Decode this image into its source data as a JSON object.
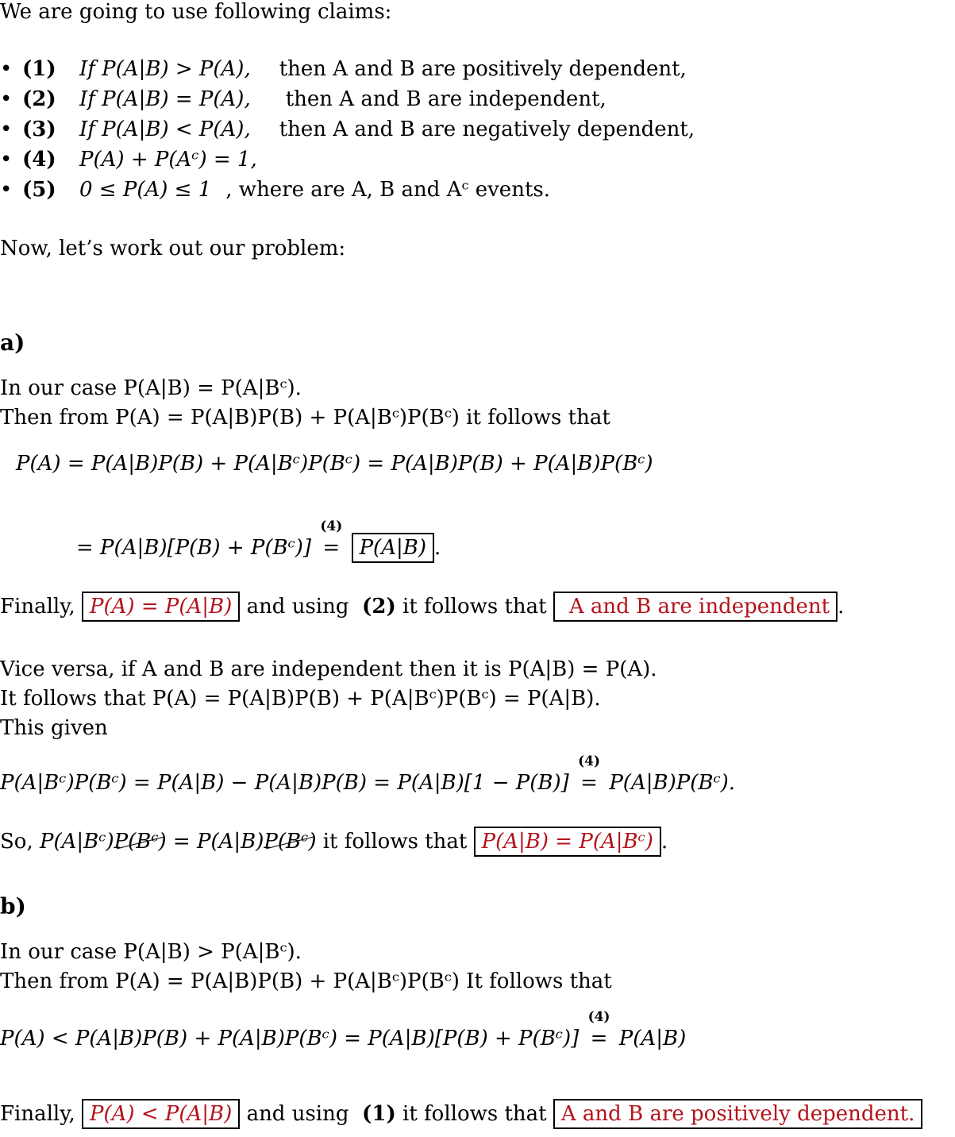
{
  "intro": "We are going to use following claims:",
  "claims": [
    {
      "label": "(1)",
      "cond": "If P(A|B) > P(A),",
      "result": "then A and B are positively dependent,"
    },
    {
      "label": "(2)",
      "cond": "If P(A|B) = P(A),",
      "result": "then A and B are independent,"
    },
    {
      "label": "(3)",
      "cond": "If P(A|B) < P(A),",
      "result": "then A and B are negatively dependent,"
    },
    {
      "label": "(4)",
      "cond": "P(A) + P(Aᶜ) = 1,",
      "result": ""
    },
    {
      "label": "(5)",
      "cond": "0 ≤ P(A) ≤ 1",
      "result": ", where are A, B and Aᶜ events."
    }
  ],
  "transition": "Now, let’s work out our problem:",
  "part_a": {
    "heading": "a)",
    "case": "In our case P(A|B) = P(A|Bᶜ).",
    "then_from": "Then from P(A) = P(A|B)P(B) + P(A|Bᶜ)P(Bᶜ) it follows that",
    "eq1": "P(A) = P(A|B)P(B) + P(A|Bᶜ)P(Bᶜ) = P(A|B)P(B) + P(A|B)P(Bᶜ)",
    "eq2_left": "= P(A|B)[P(B) + P(Bᶜ)]",
    "eq2_ref": "(4)",
    "eq2_boxed": "P(A|B)",
    "finally_prefix": "Finally,",
    "finally_box1": "P(A) = P(A|B)",
    "finally_mid": "and using",
    "finally_ref": "(2)",
    "finally_mid2": "it follows that",
    "finally_box2": "A and B are independent",
    "vice1": "Vice versa, if A and B are independent then it is P(A|B) = P(A).",
    "vice2": "It follows that P(A) = P(A|B)P(B) + P(A|Bᶜ)P(Bᶜ) = P(A|B).",
    "vice3": "This given",
    "eq3_left": "P(A|Bᶜ)P(Bᶜ) = P(A|B) − P(A|B)P(B) = P(A|B)[1 − P(B)]",
    "eq3_ref": "(4)",
    "eq3_right": "P(A|B)P(Bᶜ).",
    "so_prefix": "So,",
    "so_a": "P(A|Bᶜ)",
    "so_cancel": "P(Bᶜ)",
    "so_eq": "= P(A|B)",
    "so_suffix": "it follows that",
    "so_box": "P(A|B) = P(A|Bᶜ)"
  },
  "part_b": {
    "heading": "b)",
    "case": "In our case P(A|B) > P(A|Bᶜ).",
    "then_from": "Then from P(A) = P(A|B)P(B) + P(A|Bᶜ)P(Bᶜ) It follows that",
    "eq1_left": "P(A) < P(A|B)P(B) + P(A|B)P(Bᶜ) = P(A|B)[P(B) + P(Bᶜ)]",
    "eq1_ref": "(4)",
    "eq1_right": "P(A|B)",
    "finally_prefix": "Finally,",
    "finally_box1": "P(A) < P(A|B)",
    "finally_mid": "and using",
    "finally_ref": "(1)",
    "finally_mid2": "it follows that",
    "finally_box2": "A and B are positively dependent."
  },
  "colors": {
    "highlight": "#b3131b"
  }
}
